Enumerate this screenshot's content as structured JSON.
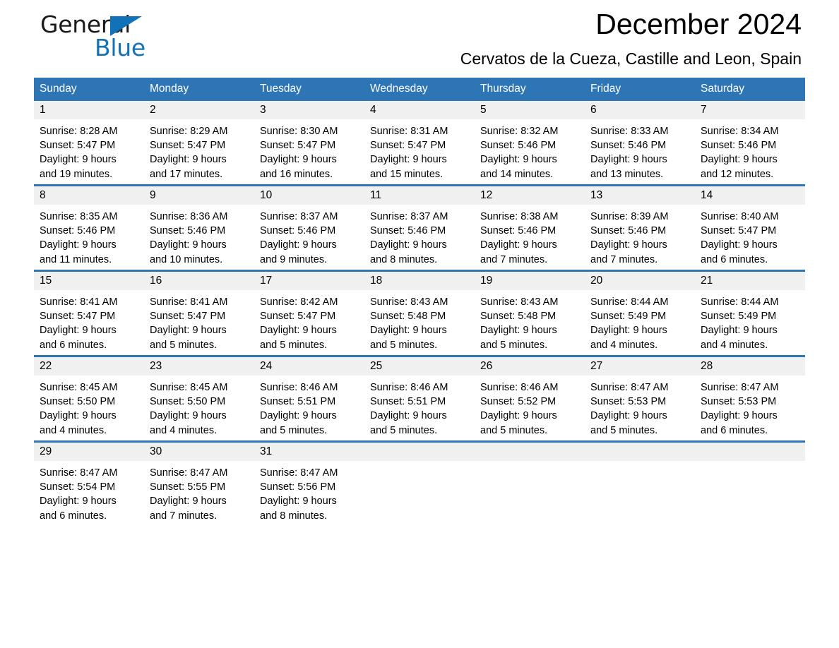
{
  "brand": {
    "name_part1": "General",
    "name_part2": "Blue",
    "accent_color": "#1272b8"
  },
  "header": {
    "title": "December 2024",
    "subtitle": "Cervatos de la Cueza, Castille and Leon, Spain"
  },
  "calendar": {
    "header_color": "#2e75b6",
    "date_band_color": "#f0f0f0",
    "weekday_headers": [
      "Sunday",
      "Monday",
      "Tuesday",
      "Wednesday",
      "Thursday",
      "Friday",
      "Saturday"
    ],
    "weeks": [
      [
        {
          "date": "1",
          "lines": [
            "Sunrise: 8:28 AM",
            "Sunset: 5:47 PM",
            "Daylight: 9 hours",
            "and 19 minutes."
          ]
        },
        {
          "date": "2",
          "lines": [
            "Sunrise: 8:29 AM",
            "Sunset: 5:47 PM",
            "Daylight: 9 hours",
            "and 17 minutes."
          ]
        },
        {
          "date": "3",
          "lines": [
            "Sunrise: 8:30 AM",
            "Sunset: 5:47 PM",
            "Daylight: 9 hours",
            "and 16 minutes."
          ]
        },
        {
          "date": "4",
          "lines": [
            "Sunrise: 8:31 AM",
            "Sunset: 5:47 PM",
            "Daylight: 9 hours",
            "and 15 minutes."
          ]
        },
        {
          "date": "5",
          "lines": [
            "Sunrise: 8:32 AM",
            "Sunset: 5:46 PM",
            "Daylight: 9 hours",
            "and 14 minutes."
          ]
        },
        {
          "date": "6",
          "lines": [
            "Sunrise: 8:33 AM",
            "Sunset: 5:46 PM",
            "Daylight: 9 hours",
            "and 13 minutes."
          ]
        },
        {
          "date": "7",
          "lines": [
            "Sunrise: 8:34 AM",
            "Sunset: 5:46 PM",
            "Daylight: 9 hours",
            "and 12 minutes."
          ]
        }
      ],
      [
        {
          "date": "8",
          "lines": [
            "Sunrise: 8:35 AM",
            "Sunset: 5:46 PM",
            "Daylight: 9 hours",
            "and 11 minutes."
          ]
        },
        {
          "date": "9",
          "lines": [
            "Sunrise: 8:36 AM",
            "Sunset: 5:46 PM",
            "Daylight: 9 hours",
            "and 10 minutes."
          ]
        },
        {
          "date": "10",
          "lines": [
            "Sunrise: 8:37 AM",
            "Sunset: 5:46 PM",
            "Daylight: 9 hours",
            "and 9 minutes."
          ]
        },
        {
          "date": "11",
          "lines": [
            "Sunrise: 8:37 AM",
            "Sunset: 5:46 PM",
            "Daylight: 9 hours",
            "and 8 minutes."
          ]
        },
        {
          "date": "12",
          "lines": [
            "Sunrise: 8:38 AM",
            "Sunset: 5:46 PM",
            "Daylight: 9 hours",
            "and 7 minutes."
          ]
        },
        {
          "date": "13",
          "lines": [
            "Sunrise: 8:39 AM",
            "Sunset: 5:46 PM",
            "Daylight: 9 hours",
            "and 7 minutes."
          ]
        },
        {
          "date": "14",
          "lines": [
            "Sunrise: 8:40 AM",
            "Sunset: 5:47 PM",
            "Daylight: 9 hours",
            "and 6 minutes."
          ]
        }
      ],
      [
        {
          "date": "15",
          "lines": [
            "Sunrise: 8:41 AM",
            "Sunset: 5:47 PM",
            "Daylight: 9 hours",
            "and 6 minutes."
          ]
        },
        {
          "date": "16",
          "lines": [
            "Sunrise: 8:41 AM",
            "Sunset: 5:47 PM",
            "Daylight: 9 hours",
            "and 5 minutes."
          ]
        },
        {
          "date": "17",
          "lines": [
            "Sunrise: 8:42 AM",
            "Sunset: 5:47 PM",
            "Daylight: 9 hours",
            "and 5 minutes."
          ]
        },
        {
          "date": "18",
          "lines": [
            "Sunrise: 8:43 AM",
            "Sunset: 5:48 PM",
            "Daylight: 9 hours",
            "and 5 minutes."
          ]
        },
        {
          "date": "19",
          "lines": [
            "Sunrise: 8:43 AM",
            "Sunset: 5:48 PM",
            "Daylight: 9 hours",
            "and 5 minutes."
          ]
        },
        {
          "date": "20",
          "lines": [
            "Sunrise: 8:44 AM",
            "Sunset: 5:49 PM",
            "Daylight: 9 hours",
            "and 4 minutes."
          ]
        },
        {
          "date": "21",
          "lines": [
            "Sunrise: 8:44 AM",
            "Sunset: 5:49 PM",
            "Daylight: 9 hours",
            "and 4 minutes."
          ]
        }
      ],
      [
        {
          "date": "22",
          "lines": [
            "Sunrise: 8:45 AM",
            "Sunset: 5:50 PM",
            "Daylight: 9 hours",
            "and 4 minutes."
          ]
        },
        {
          "date": "23",
          "lines": [
            "Sunrise: 8:45 AM",
            "Sunset: 5:50 PM",
            "Daylight: 9 hours",
            "and 4 minutes."
          ]
        },
        {
          "date": "24",
          "lines": [
            "Sunrise: 8:46 AM",
            "Sunset: 5:51 PM",
            "Daylight: 9 hours",
            "and 5 minutes."
          ]
        },
        {
          "date": "25",
          "lines": [
            "Sunrise: 8:46 AM",
            "Sunset: 5:51 PM",
            "Daylight: 9 hours",
            "and 5 minutes."
          ]
        },
        {
          "date": "26",
          "lines": [
            "Sunrise: 8:46 AM",
            "Sunset: 5:52 PM",
            "Daylight: 9 hours",
            "and 5 minutes."
          ]
        },
        {
          "date": "27",
          "lines": [
            "Sunrise: 8:47 AM",
            "Sunset: 5:53 PM",
            "Daylight: 9 hours",
            "and 5 minutes."
          ]
        },
        {
          "date": "28",
          "lines": [
            "Sunrise: 8:47 AM",
            "Sunset: 5:53 PM",
            "Daylight: 9 hours",
            "and 6 minutes."
          ]
        }
      ],
      [
        {
          "date": "29",
          "lines": [
            "Sunrise: 8:47 AM",
            "Sunset: 5:54 PM",
            "Daylight: 9 hours",
            "and 6 minutes."
          ]
        },
        {
          "date": "30",
          "lines": [
            "Sunrise: 8:47 AM",
            "Sunset: 5:55 PM",
            "Daylight: 9 hours",
            "and 7 minutes."
          ]
        },
        {
          "date": "31",
          "lines": [
            "Sunrise: 8:47 AM",
            "Sunset: 5:56 PM",
            "Daylight: 9 hours",
            "and 8 minutes."
          ]
        },
        {
          "date": "",
          "lines": []
        },
        {
          "date": "",
          "lines": []
        },
        {
          "date": "",
          "lines": []
        },
        {
          "date": "",
          "lines": []
        }
      ]
    ]
  }
}
